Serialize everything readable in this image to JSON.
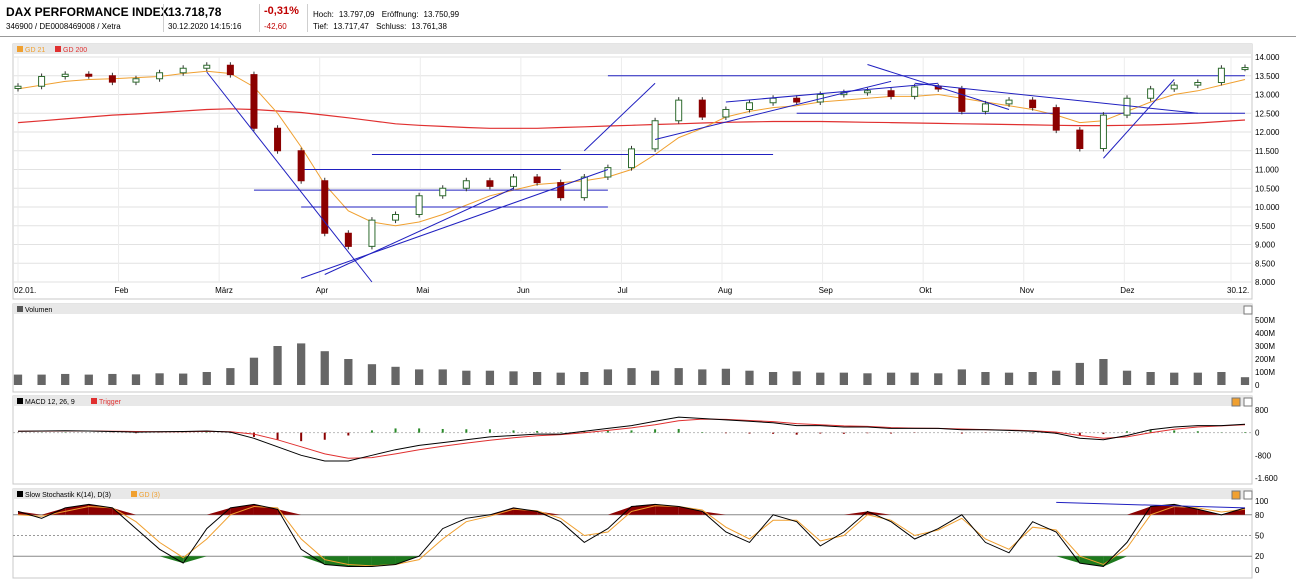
{
  "header": {
    "title": "DAX PERFORMANCE INDEX",
    "subtitle": "346900 / DE0008469008 / Xetra",
    "price": "13.718,78",
    "datetime": "30.12.2020 14:15:16",
    "change_pct": "-0,31%",
    "change_abs": "-42,60",
    "high_label": "Hoch:",
    "high_value": "13.797,09",
    "open_label": "Eröffnung:",
    "open_value": "13.750,99",
    "low_label": "Tief:",
    "low_value": "13.717,47",
    "close_label": "Schluss:",
    "close_value": "13.761,38"
  },
  "colors": {
    "up": "#ffffff",
    "down": "#8b0000",
    "candle_border": "#2f6b2f",
    "gd21": "#f0a030",
    "gd200": "#e03030",
    "trendline": "#2020c0",
    "volume": "#666666",
    "macd": "#000000",
    "trigger": "#e03030",
    "stoch_k": "#000000",
    "stoch_d": "#f0a030",
    "overbought_fill": "#8b0000",
    "oversold_fill": "#1e7a1e"
  },
  "panels": {
    "price": {
      "legend": [
        {
          "label": "GD 21",
          "color": "#f0a030"
        },
        {
          "label": "GD 200",
          "color": "#e03030"
        }
      ]
    },
    "volume": {
      "label": "Volumen"
    },
    "macd": {
      "label": "MACD 12, 26, 9",
      "trigger_label": "Trigger"
    },
    "stoch": {
      "label": "Slow Stochastik K(14), D(3)",
      "d_label": "GD (3)"
    }
  },
  "chart_data": [
    {
      "type": "candlestick",
      "title": "DAX PERFORMANCE INDEX",
      "x_tick_labels": [
        "02.01.",
        "Feb",
        "März",
        "Apr",
        "Mai",
        "Jun",
        "Jul",
        "Aug",
        "Sep",
        "Okt",
        "Nov",
        "Dez",
        "30.12."
      ],
      "y_tick_labels": [
        "14.000",
        "13.500",
        "13.000",
        "12.500",
        "12.000",
        "11.500",
        "11.000",
        "10.500",
        "10.000",
        "9.500",
        "9.000",
        "8.500",
        "8.000"
      ],
      "ylim": [
        8000,
        14000
      ],
      "x_range_weeks": [
        0,
        52
      ],
      "grid": true,
      "legend_position": "top-left",
      "series": [
        {
          "name": "GD 21",
          "type": "line"
        },
        {
          "name": "GD 200",
          "type": "line"
        }
      ],
      "weekly_close": [
        13220,
        13480,
        13540,
        13500,
        13330,
        13420,
        13580,
        13700,
        13780,
        13530,
        12100,
        11500,
        10700,
        9300,
        8950,
        9650,
        9800,
        10300,
        10500,
        10700,
        10550,
        10800,
        10650,
        10250,
        10800,
        11050,
        11550,
        12300,
        12850,
        12400,
        12600,
        12780,
        12900,
        12800,
        13000,
        13050,
        13100,
        12950,
        13200,
        13150,
        12550,
        12750,
        12850,
        12650,
        12050,
        11560,
        12450,
        12900,
        13150,
        13250,
        13320,
        13700,
        13718.78
      ],
      "gd21_weekly": [
        13150,
        13250,
        13350,
        13400,
        13420,
        13450,
        13480,
        13560,
        13620,
        13560,
        13200,
        12500,
        11600,
        10600,
        9900,
        9600,
        9500,
        9600,
        9800,
        10050,
        10300,
        10450,
        10600,
        10650,
        10700,
        10800,
        11000,
        11400,
        11850,
        12100,
        12400,
        12550,
        12650,
        12700,
        12800,
        12850,
        12900,
        12950,
        12950,
        13000,
        12900,
        12800,
        12700,
        12600,
        12450,
        12250,
        12300,
        12550,
        12800,
        13000,
        13100,
        13250,
        13400
      ],
      "gd200_weekly": [
        12250,
        12300,
        12350,
        12400,
        12450,
        12480,
        12520,
        12560,
        12600,
        12620,
        12600,
        12560,
        12520,
        12450,
        12380,
        12300,
        12220,
        12180,
        12150,
        12120,
        12100,
        12100,
        12100,
        12120,
        12140,
        12160,
        12180,
        12200,
        12220,
        12240,
        12260,
        12270,
        12280,
        12280,
        12280,
        12270,
        12260,
        12250,
        12240,
        12230,
        12220,
        12210,
        12200,
        12190,
        12180,
        12170,
        12170,
        12180,
        12190,
        12210,
        12240,
        12280,
        12320
      ],
      "horizontal_levels": [
        13500,
        12500,
        11400,
        11000,
        10450,
        10000
      ],
      "notes_series_from_chart": "weekly approximations read from the chart"
    },
    {
      "type": "bar",
      "title": "Volumen",
      "y_tick_labels": [
        "500M",
        "400M",
        "300M",
        "200M",
        "100M",
        "0"
      ],
      "ylim": [
        0,
        500
      ],
      "y_unit": "M",
      "values": [
        80,
        80,
        85,
        80,
        85,
        82,
        90,
        88,
        100,
        130,
        210,
        300,
        320,
        260,
        200,
        160,
        140,
        120,
        120,
        110,
        110,
        105,
        100,
        95,
        100,
        120,
        130,
        110,
        130,
        120,
        125,
        110,
        100,
        105,
        95,
        95,
        90,
        95,
        95,
        90,
        120,
        100,
        95,
        100,
        110,
        170,
        200,
        110,
        100,
        95,
        95,
        100,
        60
      ]
    },
    {
      "type": "line",
      "title": "MACD 12, 26, 9",
      "y_tick_labels": [
        "800",
        "0",
        "-800",
        "-1.600"
      ],
      "ylim": [
        -1600,
        800
      ],
      "series": [
        {
          "name": "MACD 12, 26, 9",
          "values": [
            50,
            60,
            70,
            60,
            40,
            20,
            30,
            40,
            60,
            20,
            -200,
            -500,
            -800,
            -1000,
            -1000,
            -800,
            -600,
            -450,
            -350,
            -250,
            -150,
            -100,
            -50,
            -50,
            50,
            150,
            250,
            400,
            550,
            500,
            450,
            400,
            350,
            250,
            250,
            200,
            200,
            150,
            150,
            150,
            100,
            100,
            80,
            50,
            -20,
            -200,
            -250,
            -100,
            100,
            200,
            250,
            250,
            300
          ]
        },
        {
          "name": "Trigger",
          "values": [
            50,
            55,
            60,
            60,
            50,
            40,
            35,
            35,
            45,
            35,
            -50,
            -250,
            -500,
            -750,
            -900,
            -880,
            -750,
            -600,
            -480,
            -370,
            -270,
            -180,
            -110,
            -70,
            0,
            80,
            170,
            280,
            420,
            480,
            470,
            430,
            390,
            320,
            280,
            240,
            220,
            180,
            160,
            150,
            130,
            110,
            90,
            70,
            20,
            -100,
            -200,
            -150,
            0,
            120,
            200,
            240,
            280
          ]
        }
      ]
    },
    {
      "type": "line",
      "title": "Slow Stochastik K(14), D(3)",
      "y_tick_labels": [
        "100",
        "80",
        "50",
        "20",
        "0"
      ],
      "ylim": [
        0,
        100
      ],
      "levels": [
        80,
        50,
        20
      ],
      "series": [
        {
          "name": "K(14)",
          "values": [
            85,
            75,
            90,
            95,
            90,
            60,
            30,
            10,
            60,
            90,
            95,
            88,
            30,
            8,
            5,
            5,
            8,
            20,
            60,
            75,
            80,
            90,
            85,
            70,
            40,
            60,
            92,
            95,
            92,
            85,
            55,
            40,
            80,
            70,
            35,
            55,
            85,
            70,
            45,
            60,
            80,
            40,
            25,
            70,
            55,
            10,
            5,
            40,
            92,
            95,
            88,
            80,
            90
          ]
        },
        {
          "name": "GD (3)",
          "values": [
            80,
            78,
            85,
            92,
            90,
            70,
            40,
            18,
            45,
            80,
            92,
            90,
            45,
            15,
            8,
            6,
            8,
            15,
            45,
            70,
            78,
            88,
            86,
            75,
            50,
            55,
            85,
            93,
            92,
            87,
            62,
            45,
            72,
            72,
            42,
            50,
            80,
            72,
            50,
            58,
            75,
            45,
            30,
            62,
            58,
            20,
            8,
            32,
            80,
            92,
            90,
            84,
            88
          ]
        }
      ]
    }
  ]
}
